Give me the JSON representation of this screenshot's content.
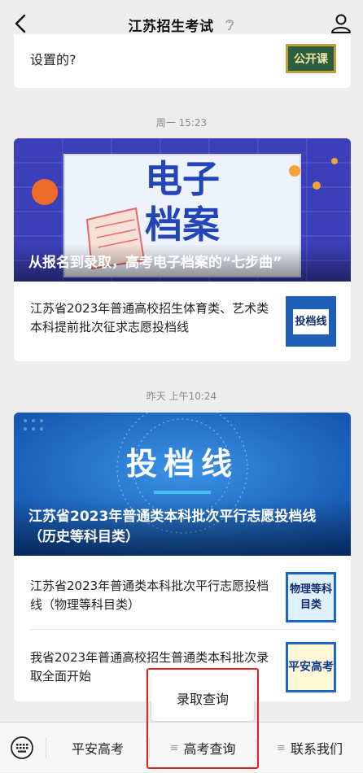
{
  "nav": {
    "title": "江苏招生考试"
  },
  "feed": {
    "card1": {
      "text": "设置的?",
      "thumb": "公开课"
    },
    "time1": "周一 15:23",
    "card2": {
      "hero_text_line1": "电子",
      "hero_text_line2": "档案",
      "hero_caption": "从报名到录取，高考电子档案的“七步曲”",
      "item1": {
        "text": "江苏省2023年普通高校招生体育类、艺术类本科提前批次征求志愿投档线",
        "thumb": "投档线"
      }
    },
    "time2": "昨天 上午10:24",
    "card3": {
      "hero_text": "投档线",
      "hero_caption": "江苏省2023年普通类本科批次平行志愿投档线（历史等科目类）",
      "item1": {
        "text": "江苏省2023年普通类本科批次平行志愿投档线（物理等科目类）",
        "thumb": "物理等科目类"
      },
      "item2": {
        "text": "我省2023年普通高校招生普通类本科批次录取全面开始",
        "thumb": "平安高考"
      }
    }
  },
  "popup": {
    "label": "录取查询"
  },
  "bottom_menu": {
    "items": [
      {
        "label": "平安高考"
      },
      {
        "label": "高考查询"
      },
      {
        "label": "联系我们"
      }
    ],
    "hamburger": "≡"
  },
  "icons": {
    "back": "chevron-left-icon",
    "ear": "ear-icon",
    "profile": "person-icon",
    "keyboard": "keyboard-icon"
  },
  "colors": {
    "highlight_box": "#e02020",
    "hero2_bg": "#3b3fb8",
    "hero3_bg": "#1a66c2"
  }
}
